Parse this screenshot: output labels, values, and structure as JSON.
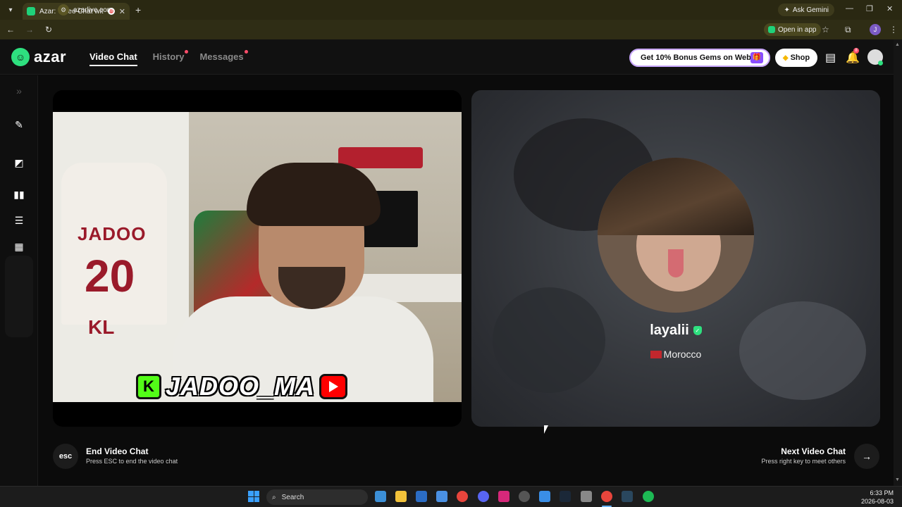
{
  "browser": {
    "tab_title": "Azar: Video Chat with New",
    "tab_menu_icon": "chevron-down-icon",
    "ask_gemini": "Ask Gemini",
    "url": "azarlive.com",
    "open_in_app": "Open in app",
    "profile_initial": "J"
  },
  "header": {
    "logo_text": "azar",
    "nav": [
      {
        "label": "Video Chat",
        "active": true,
        "dot": false
      },
      {
        "label": "History",
        "active": false,
        "dot": true
      },
      {
        "label": "Messages",
        "active": false,
        "dot": true
      }
    ],
    "bonus_label": "Get 10% Bonus Gems on Web!",
    "shop_label": "Shop",
    "notification_badge": "8"
  },
  "local_video": {
    "jersey_name": "JADOO",
    "jersey_number": "20",
    "jersey_kl": "KL",
    "overlay_handle": "JADOO_MA",
    "kick_letter": "K"
  },
  "peer": {
    "name": "layalii",
    "country": "Morocco"
  },
  "controls": {
    "esc_key": "esc",
    "end_title": "End Video Chat",
    "end_sub": "Press ESC to end the video chat",
    "next_title": "Next Video Chat",
    "next_sub": "Press right key to meet others",
    "next_arrow": "→"
  },
  "taskbar": {
    "search_placeholder": "Search",
    "time": "6:33 PM",
    "date": "2026-08-03"
  },
  "colors": {
    "accent": "#2ee07f",
    "notification": "#ff4d6a",
    "browser_frame": "#2a2812"
  }
}
